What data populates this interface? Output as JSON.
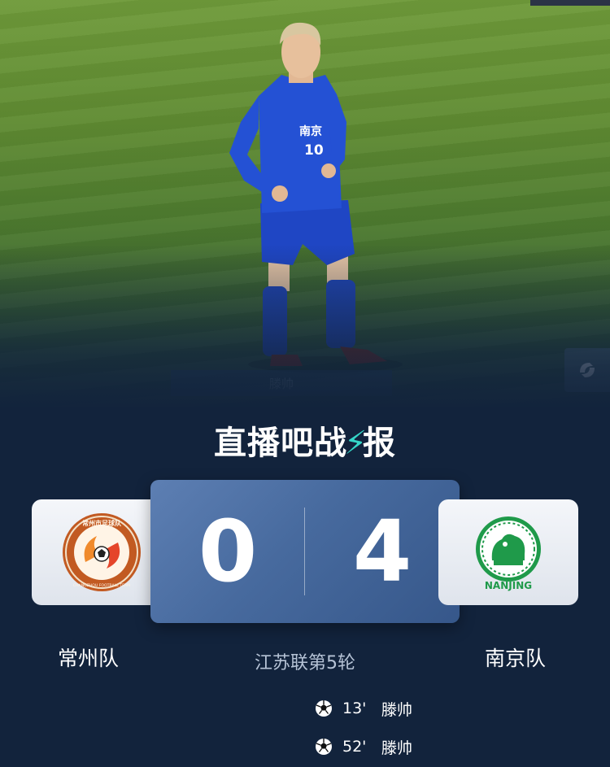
{
  "header": {
    "title_main": "直播吧战",
    "title_end": "报"
  },
  "photo": {
    "broadcast_bar_text": "滕帅",
    "player_shirt_text": "南京",
    "player_shirt_number": "10"
  },
  "match": {
    "home_team": "常州队",
    "away_team": "南京队",
    "home_score": "0",
    "away_score": "4",
    "competition": "江苏联第5轮",
    "home_logo_text": "常州市足球队",
    "home_logo_subtext": "CHANGZHOU FOOTBALL TEAM",
    "away_logo_text": "NANJING"
  },
  "events": [
    {
      "icon": "soccer-ball-icon",
      "minute": "13'",
      "player": "滕帅"
    },
    {
      "icon": "soccer-ball-icon",
      "minute": "52'",
      "player": "滕帅"
    }
  ],
  "colors": {
    "background": "#12233c",
    "scoreboard": "#476a9e",
    "accent": "#35d6c8",
    "home_brand": "#c25a22",
    "away_brand": "#1f9a4a"
  }
}
